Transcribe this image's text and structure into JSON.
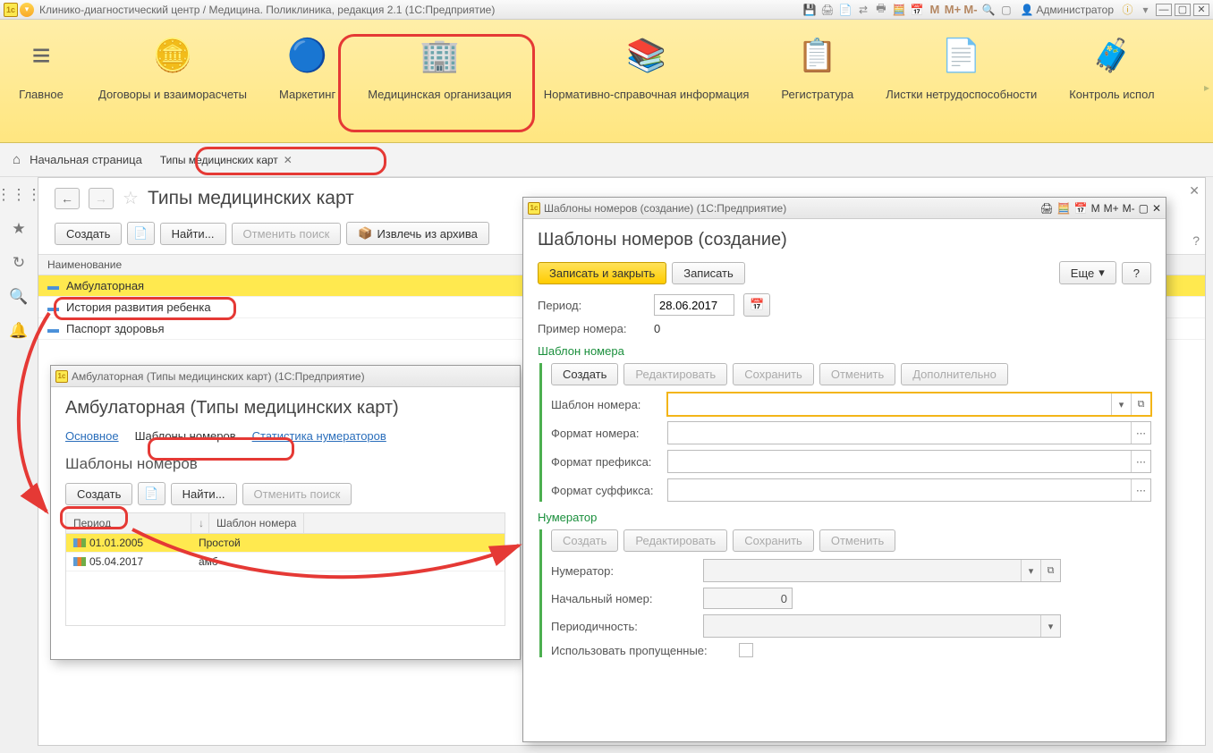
{
  "titlebar": {
    "app_title": "Клинико-диагностический центр / Медицина. Поликлиника, редакция 2.1  (1С:Предприятие)",
    "user": "Администратор"
  },
  "main_toolbar": {
    "items": [
      {
        "label": "Главное"
      },
      {
        "label": "Договоры и взаиморасчеты"
      },
      {
        "label": "Маркетинг"
      },
      {
        "label": "Медицинская организация"
      },
      {
        "label": "Нормативно-справочная информация"
      },
      {
        "label": "Регистратура"
      },
      {
        "label": "Листки нетрудоспособности"
      },
      {
        "label": "Контроль испол"
      }
    ]
  },
  "breadcrumb": {
    "home": "Начальная страница",
    "tab": "Типы медицинских карт"
  },
  "main_panel": {
    "title": "Типы медицинских карт",
    "toolbar": {
      "create": "Создать",
      "find": "Найти...",
      "cancel": "Отменить поиск",
      "extract": "Извлечь из архива"
    },
    "column_header": "Наименование",
    "rows": [
      "Амбулаторная",
      "История развития ребенка",
      "Паспорт здоровья"
    ]
  },
  "subwin1": {
    "titlebar": "Амбулаторная (Типы медицинских карт)  (1С:Предприятие)",
    "heading": "Амбулаторная (Типы медицинских карт)",
    "tabs": {
      "main": "Основное",
      "templates": "Шаблоны номеров",
      "stats": "Статистика нумераторов"
    },
    "subheading": "Шаблоны номеров",
    "toolbar": {
      "create": "Создать",
      "find": "Найти...",
      "cancel": "Отменить поиск"
    },
    "columns": {
      "period": "Период",
      "template": "Шаблон номера"
    },
    "rows": [
      {
        "date": "01.01.2005",
        "template": "Простой"
      },
      {
        "date": "05.04.2017",
        "template": "амб"
      }
    ]
  },
  "subwin2": {
    "titlebar": "Шаблоны номеров (создание)  (1С:Предприятие)",
    "heading": "Шаблоны номеров (создание)",
    "toolbar": {
      "save_close": "Записать и закрыть",
      "save": "Записать",
      "more": "Еще",
      "help": "?"
    },
    "period_label": "Период:",
    "period_value": "28.06.2017",
    "example_label": "Пример номера:",
    "example_value": "0",
    "section_template": "Шаблон номера",
    "template_toolbar": {
      "create": "Создать",
      "edit": "Редактировать",
      "save": "Сохранить",
      "cancel": "Отменить",
      "extra": "Дополнительно"
    },
    "fields": {
      "template": "Шаблон номера:",
      "num_format": "Формат номера:",
      "prefix_format": "Формат префикса:",
      "suffix_format": "Формат суффикса:"
    },
    "section_numerator": "Нумератор",
    "numerator_toolbar": {
      "create": "Создать",
      "edit": "Редактировать",
      "save": "Сохранить",
      "cancel": "Отменить"
    },
    "numerator_fields": {
      "numerator": "Нумератор:",
      "start_num": "Начальный номер:",
      "start_num_value": "0",
      "periodicity": "Периодичность:",
      "use_skipped": "Использовать пропущенные:"
    }
  }
}
